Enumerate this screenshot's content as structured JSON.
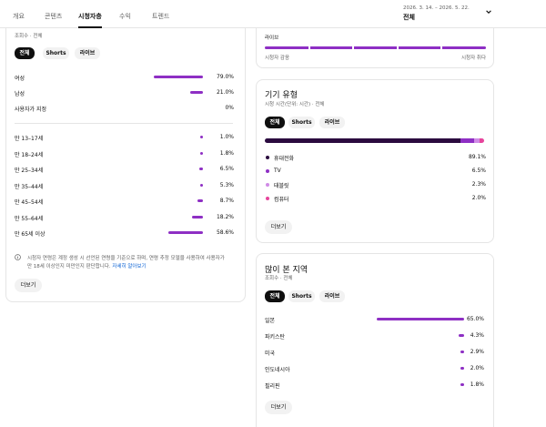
{
  "tabs": [
    {
      "label": "개요"
    },
    {
      "label": "콘텐츠"
    },
    {
      "label": "시청자층",
      "active": true
    },
    {
      "label": "수익"
    },
    {
      "label": "트렌드"
    }
  ],
  "date_picker": {
    "range": "2026. 3. 14. – 2026. 5. 22.",
    "label": "전체"
  },
  "demographics": {
    "subtitle": "조회수 · 전체",
    "filters": [
      "전체",
      "Shorts",
      "라이브"
    ],
    "gender": [
      {
        "label": "여성",
        "value": "79.0%",
        "fraction": 0.79
      },
      {
        "label": "남성",
        "value": "21.0%",
        "fraction": 0.21
      },
      {
        "label": "사용자가 지정",
        "value": "0%",
        "fraction": 0
      }
    ],
    "age": [
      {
        "label": "만 13–17세",
        "value": "1.0%",
        "fraction": 0.01
      },
      {
        "label": "만 18–24세",
        "value": "1.8%",
        "fraction": 0.018
      },
      {
        "label": "만 25–34세",
        "value": "6.5%",
        "fraction": 0.065
      },
      {
        "label": "만 35–44세",
        "value": "5.3%",
        "fraction": 0.053
      },
      {
        "label": "만 45–54세",
        "value": "8.7%",
        "fraction": 0.087
      },
      {
        "label": "만 55–64세",
        "value": "18.2%",
        "fraction": 0.182
      },
      {
        "label": "만 65세 이상",
        "value": "58.6%",
        "fraction": 0.586
      }
    ],
    "note": "시청자 연령은 계정 생성 시 선언된 연령을 기준으로 하며, 연령 추정 모델을 사용하여 사용자가",
    "note2": "만 18세 이상인지 미만인지 판단합니다.",
    "note_link": "자세히 알아보기",
    "more": "더보기"
  },
  "top_partial_card": {
    "label": "라이브",
    "axis_left": "시청자 감응",
    "axis_right": "시청자 취다"
  },
  "device_type": {
    "title": "기기 유형",
    "subtitle": "시청 시간(단위: 시간) · 전체",
    "filters": [
      "전체",
      "Shorts",
      "라이브"
    ],
    "items": [
      {
        "label": "휴대전화",
        "value": "89.1%",
        "fraction": 0.891,
        "color": "#2b0b3f"
      },
      {
        "label": "TV",
        "value": "6.5%",
        "fraction": 0.065,
        "color": "#8e2fc4"
      },
      {
        "label": "태블릿",
        "value": "2.3%",
        "fraction": 0.023,
        "color": "#d08be6"
      },
      {
        "label": "컴퓨터",
        "value": "2.0%",
        "fraction": 0.02,
        "color": "#e6449c"
      }
    ],
    "more": "더보기"
  },
  "top_regions": {
    "title": "많이 본 지역",
    "subtitle": "조회수 · 전체",
    "filters": [
      "전체",
      "Shorts",
      "라이브"
    ],
    "items": [
      {
        "label": "일본",
        "value": "65.0%",
        "fraction": 0.65
      },
      {
        "label": "파키스탄",
        "value": "4.3%",
        "fraction": 0.043
      },
      {
        "label": "미국",
        "value": "2.9%",
        "fraction": 0.029
      },
      {
        "label": "인도네시아",
        "value": "2.0%",
        "fraction": 0.02
      },
      {
        "label": "필리핀",
        "value": "1.8%",
        "fraction": 0.018
      }
    ],
    "more": "더보기"
  },
  "colors": {
    "accent": "#8e2fc4",
    "dark": "#0f0f0f"
  }
}
